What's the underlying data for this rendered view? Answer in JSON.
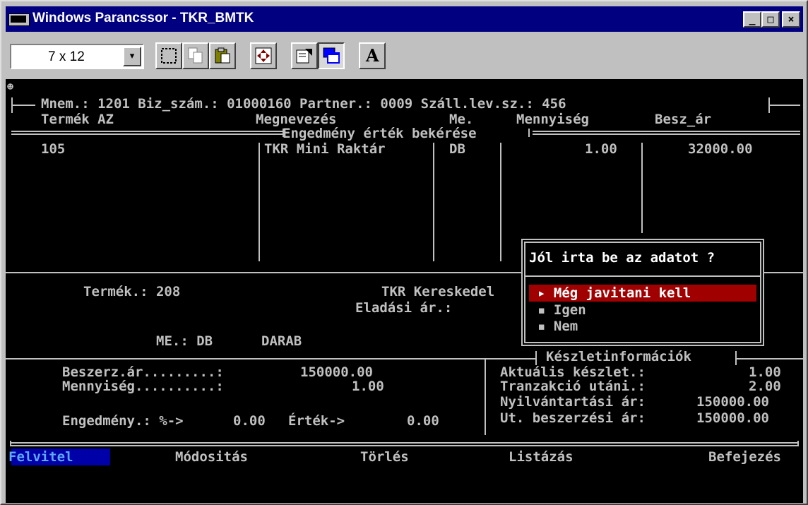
{
  "window": {
    "title": "Windows Parancssor - TKR_BMTK",
    "min_label": "_",
    "max_label": "□",
    "close_label": "×"
  },
  "toolbar": {
    "font_size": "7 x 12",
    "dropdown_arrow": "▾",
    "font_button_label": "A"
  },
  "console_icon": "☻",
  "header": {
    "line1": "Mnem.: 1201 Biz_szám.: 01000160 Partner.: 0009 Száll.lev.sz.: 456",
    "col_termek": "Termék AZ",
    "col_megnevezes": "Megnevezés",
    "col_me": "Me.",
    "col_mennyiseg": "Mennyiség",
    "col_besz_ar": "Besz_ár",
    "section_title": "Engedmény érték bekérése"
  },
  "rows": [
    {
      "termek": "105",
      "megnevezes": "TKR Mini Raktár",
      "me": "DB",
      "mennyiseg": "1.00",
      "besz_ar": "32000.00"
    }
  ],
  "detail": {
    "termek_label": "Termék.: 208",
    "name_partial": "TKR Kereskedel",
    "eladasi_label": "Eladási ár.:",
    "me_label": "ME.: DB",
    "me_value": "DARAB"
  },
  "dialog": {
    "question": "Jól irta be az adatot ?",
    "options": [
      "▸ Még javitani kell",
      "▪ Igen",
      "▪ Nem"
    ]
  },
  "stock": {
    "title": "Készletinformációk",
    "aktualis_label": "Aktuális készlet.:",
    "aktualis_value": "1.00",
    "tranzakcio_label": "Tranzakció utáni.:",
    "tranzakcio_value": "2.00",
    "nyilvantartasi_label": "Nyilvántartási ár:",
    "nyilvantartasi_value": "150000.00",
    "utolso_label": "Ut. beszerzési ár:",
    "utolso_value": "150000.00"
  },
  "purchase": {
    "beszerz_label": "Beszerz.ár.........:",
    "beszerz_value": "150000.00",
    "mennyiseg_label": "Mennyiség..........:",
    "mennyiseg_value": "1.00",
    "engedmeny_label": "Engedmény.: %->",
    "engedmeny_pct": "0.00",
    "ertek_label": "Érték->",
    "ertek_value": "0.00"
  },
  "menu": [
    "Felvitel",
    "Módositás",
    "Törlés",
    "Listázás",
    "Befejezés"
  ],
  "colors": {
    "titlebar": "#000080",
    "selection": "#a00000",
    "menu_active": "#0000a8",
    "console_fg": "#c0c0c0"
  }
}
